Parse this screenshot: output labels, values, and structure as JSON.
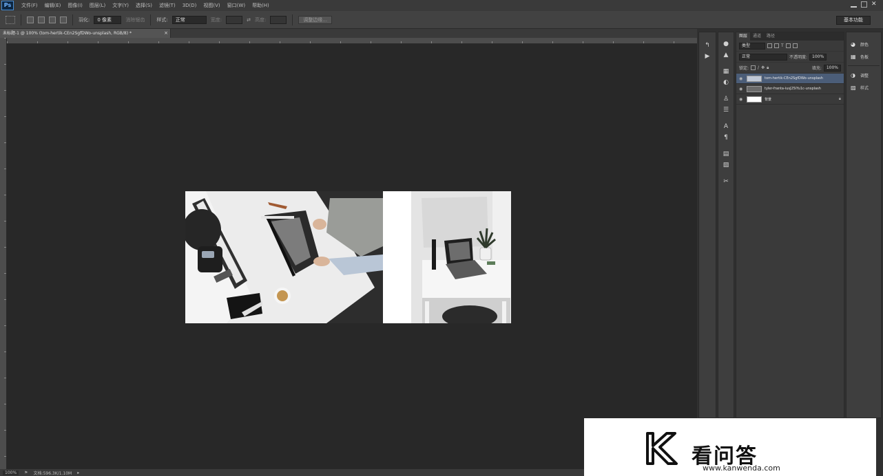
{
  "app": {
    "logo": "Ps"
  },
  "menu": [
    "文件(F)",
    "编辑(E)",
    "图像(I)",
    "图层(L)",
    "文字(Y)",
    "选择(S)",
    "滤镜(T)",
    "3D(D)",
    "视图(V)",
    "窗口(W)",
    "帮助(H)"
  ],
  "options": {
    "feather_label": "羽化:",
    "feather_value": "0 像素",
    "antialias": "消除锯齿",
    "style_label": "样式:",
    "style_value": "正常",
    "width_label": "宽度:",
    "height_label": "高度:",
    "refine_button": "调整边缘...",
    "workspace": "基本功能"
  },
  "document": {
    "tab_title": "未标题-1 @ 100% (tom-hertik-CEn2SgfDWo-unsplash, RGB/8) *",
    "status_zoom": "100%",
    "status_doc": "文档:596.3K/1.10M"
  },
  "layers_panel": {
    "tabs": [
      "图层",
      "通道",
      "路径"
    ],
    "kind_label": "类型",
    "blend_mode": "正常",
    "opacity_label": "不透明度:",
    "opacity_value": "100%",
    "lock_label": "锁定:",
    "fill_label": "填充:",
    "fill_value": "100%",
    "layers": [
      {
        "name": "tom-hertik-CEn2SgfDWo-unsplash",
        "selected": true
      },
      {
        "name": "tyler-franta-iusJ25iYu1c-unsplash",
        "selected": false
      },
      {
        "name": "背景",
        "selected": false
      }
    ]
  },
  "side_panel": [
    "颜色",
    "色板",
    "调整",
    "样式"
  ],
  "watermark": {
    "brand": "看问答",
    "url": "www.kanwenda.com"
  }
}
